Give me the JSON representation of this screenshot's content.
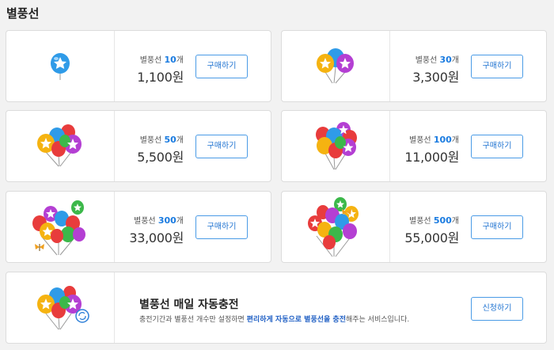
{
  "page": {
    "title": "별풍선"
  },
  "count_prefix": "별풍선",
  "count_suffix": "개",
  "products": [
    {
      "count": "10",
      "price": "1,100원",
      "button": "구매하기"
    },
    {
      "count": "30",
      "price": "3,300원",
      "button": "구매하기"
    },
    {
      "count": "50",
      "price": "5,500원",
      "button": "구매하기"
    },
    {
      "count": "100",
      "price": "11,000원",
      "button": "구매하기"
    },
    {
      "count": "300",
      "price": "33,000원",
      "button": "구매하기"
    },
    {
      "count": "500",
      "price": "55,000원",
      "button": "구매하기"
    }
  ],
  "subscription": {
    "title": "별풍선 매일 자동충전",
    "desc_before": "충전기간과 별풍선 개수만 설정하면 ",
    "desc_highlight": "편리하게 자동으로 별풍선을 충전",
    "desc_after": "해주는 서비스입니다.",
    "button": "신청하기"
  },
  "colors": {
    "accent": "#1f73d1",
    "count_blue": "#1a7be0",
    "border": "#dcdcdc"
  },
  "icons": [
    "balloon-icon",
    "star-icon",
    "butterfly-icon",
    "refresh-icon"
  ]
}
